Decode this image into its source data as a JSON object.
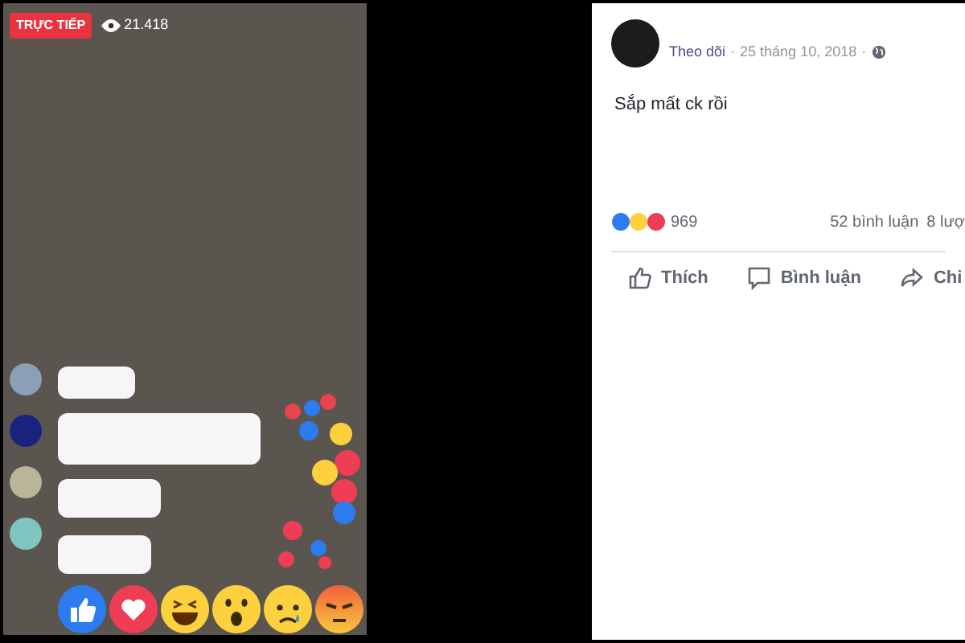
{
  "live_video": {
    "badge": "TRỰC TIẾP",
    "viewers": "21.418"
  },
  "post": {
    "follow": "Theo dõi",
    "separator": "·",
    "date": "25 tháng 10, 2018",
    "separator_2": "·",
    "text": "Sắp mất ck rồi",
    "reaction_count": "969",
    "comments": "52 bình luận",
    "shares": "8 lượ",
    "actions": [
      {
        "kind": "like",
        "label": "Thích"
      },
      {
        "kind": "comment",
        "label": "Bình luận"
      },
      {
        "kind": "share",
        "label": "Chi"
      }
    ]
  }
}
